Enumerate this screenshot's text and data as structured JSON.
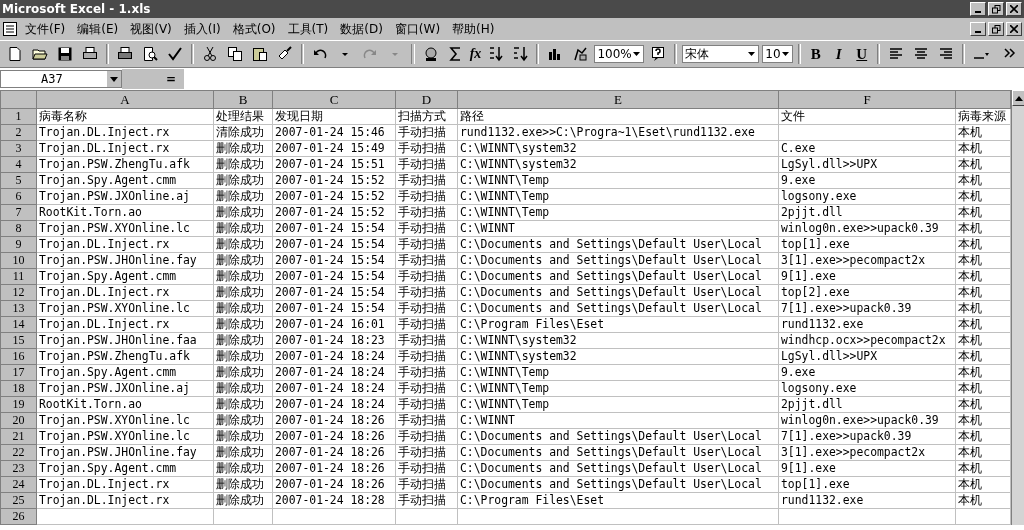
{
  "window": {
    "title": "Microsoft Excel - 1.xls"
  },
  "menu": [
    "文件(F)",
    "编辑(E)",
    "视图(V)",
    "插入(I)",
    "格式(O)",
    "工具(T)",
    "数据(D)",
    "窗口(W)",
    "帮助(H)"
  ],
  "toolbar": {
    "function_button": "fx",
    "zoom": "100%",
    "font": "宋体",
    "font_size": "10",
    "format_buttons": [
      "B",
      "I",
      "U"
    ]
  },
  "formula_bar": {
    "name_box": "A37",
    "equals": "="
  },
  "columns": [
    "A",
    "B",
    "C",
    "D",
    "E",
    "F"
  ],
  "rows": [
    {
      "number": "1",
      "cells": [
        "病毒名称",
        "处理结果",
        "发现日期",
        "扫描方式",
        "路径",
        "文件",
        "病毒来源"
      ]
    },
    {
      "number": "2",
      "cells": [
        "Trojan.DL.Inject.rx",
        "清除成功",
        "2007-01-24 15:46",
        "手动扫描",
        "rund1132.exe>>C:\\Progra~1\\Eset\\rund1132.exe",
        null,
        "本机"
      ]
    },
    {
      "number": "3",
      "cells": [
        "Trojan.DL.Inject.rx",
        "删除成功",
        "2007-01-24 15:49",
        "手动扫描",
        "C:\\WINNT\\system32",
        "C.exe",
        "本机"
      ]
    },
    {
      "number": "4",
      "cells": [
        "Trojan.PSW.ZhengTu.afk",
        "删除成功",
        "2007-01-24 15:51",
        "手动扫描",
        "C:\\WINNT\\system32",
        "LgSyl.dll>>UPX",
        "本机"
      ]
    },
    {
      "number": "5",
      "cells": [
        "Trojan.Spy.Agent.cmm",
        "删除成功",
        "2007-01-24 15:52",
        "手动扫描",
        "C:\\WINNT\\Temp",
        "9.exe",
        "本机"
      ]
    },
    {
      "number": "6",
      "cells": [
        "Trojan.PSW.JXOnline.aj",
        "删除成功",
        "2007-01-24 15:52",
        "手动扫描",
        "C:\\WINNT\\Temp",
        "logsony.exe",
        "本机"
      ]
    },
    {
      "number": "7",
      "cells": [
        "RootKit.Torn.ao",
        "删除成功",
        "2007-01-24 15:52",
        "手动扫描",
        "C:\\WINNT\\Temp",
        "2pjjt.dll",
        "本机"
      ]
    },
    {
      "number": "8",
      "cells": [
        "Trojan.PSW.XYOnline.lc",
        "删除成功",
        "2007-01-24 15:54",
        "手动扫描",
        "C:\\WINNT",
        "winlog0n.exe>>upack0.39",
        "本机"
      ]
    },
    {
      "number": "9",
      "cells": [
        "Trojan.DL.Inject.rx",
        "删除成功",
        "2007-01-24 15:54",
        "手动扫描",
        "C:\\Documents and Settings\\Default User\\Local",
        "top[1].exe",
        "本机"
      ]
    },
    {
      "number": "10",
      "cells": [
        "Trojan.PSW.JHOnline.fay",
        "删除成功",
        "2007-01-24 15:54",
        "手动扫描",
        "C:\\Documents and Settings\\Default User\\Local",
        "3[1].exe>>pecompact2x",
        "本机"
      ]
    },
    {
      "number": "11",
      "cells": [
        "Trojan.Spy.Agent.cmm",
        "删除成功",
        "2007-01-24 15:54",
        "手动扫描",
        "C:\\Documents and Settings\\Default User\\Local",
        "9[1].exe",
        "本机"
      ]
    },
    {
      "number": "12",
      "cells": [
        "Trojan.DL.Inject.rx",
        "删除成功",
        "2007-01-24 15:54",
        "手动扫描",
        "C:\\Documents and Settings\\Default User\\Local",
        "top[2].exe",
        "本机"
      ]
    },
    {
      "number": "13",
      "cells": [
        "Trojan.PSW.XYOnline.lc",
        "删除成功",
        "2007-01-24 15:54",
        "手动扫描",
        "C:\\Documents and Settings\\Default User\\Local",
        "7[1].exe>>upack0.39",
        "本机"
      ]
    },
    {
      "number": "14",
      "cells": [
        "Trojan.DL.Inject.rx",
        "删除成功",
        "2007-01-24 16:01",
        "手动扫描",
        "C:\\Program Files\\Eset",
        "rund1132.exe",
        "本机"
      ]
    },
    {
      "number": "15",
      "cells": [
        "Trojan.PSW.JHOnline.faa",
        "删除成功",
        "2007-01-24 18:23",
        "手动扫描",
        "C:\\WINNT\\system32",
        "windhcp.ocx>>pecompact2x",
        "本机"
      ]
    },
    {
      "number": "16",
      "cells": [
        "Trojan.PSW.ZhengTu.afk",
        "删除成功",
        "2007-01-24 18:24",
        "手动扫描",
        "C:\\WINNT\\system32",
        "LgSyl.dll>>UPX",
        "本机"
      ]
    },
    {
      "number": "17",
      "cells": [
        "Trojan.Spy.Agent.cmm",
        "删除成功",
        "2007-01-24 18:24",
        "手动扫描",
        "C:\\WINNT\\Temp",
        "9.exe",
        "本机"
      ]
    },
    {
      "number": "18",
      "cells": [
        "Trojan.PSW.JXOnline.aj",
        "删除成功",
        "2007-01-24 18:24",
        "手动扫描",
        "C:\\WINNT\\Temp",
        "logsony.exe",
        "本机"
      ]
    },
    {
      "number": "19",
      "cells": [
        "RootKit.Torn.ao",
        "删除成功",
        "2007-01-24 18:24",
        "手动扫描",
        "C:\\WINNT\\Temp",
        "2pjjt.dll",
        "本机"
      ]
    },
    {
      "number": "20",
      "cells": [
        "Trojan.PSW.XYOnline.lc",
        "删除成功",
        "2007-01-24 18:26",
        "手动扫描",
        "C:\\WINNT",
        "winlog0n.exe>>upack0.39",
        "本机"
      ]
    },
    {
      "number": "21",
      "cells": [
        "Trojan.PSW.XYOnline.lc",
        "删除成功",
        "2007-01-24 18:26",
        "手动扫描",
        "C:\\Documents and Settings\\Default User\\Local",
        "7[1].exe>>upack0.39",
        "本机"
      ]
    },
    {
      "number": "22",
      "cells": [
        "Trojan.PSW.JHOnline.fay",
        "删除成功",
        "2007-01-24 18:26",
        "手动扫描",
        "C:\\Documents and Settings\\Default User\\Local",
        "3[1].exe>>pecompact2x",
        "本机"
      ]
    },
    {
      "number": "23",
      "cells": [
        "Trojan.Spy.Agent.cmm",
        "删除成功",
        "2007-01-24 18:26",
        "手动扫描",
        "C:\\Documents and Settings\\Default User\\Local",
        "9[1].exe",
        "本机"
      ]
    },
    {
      "number": "24",
      "cells": [
        "Trojan.DL.Inject.rx",
        "删除成功",
        "2007-01-24 18:26",
        "手动扫描",
        "C:\\Documents and Settings\\Default User\\Local",
        "top[1].exe",
        "本机"
      ]
    },
    {
      "number": "25",
      "cells": [
        "Trojan.DL.Inject.rx",
        "删除成功",
        "2007-01-24 18:28",
        "手动扫描",
        "C:\\Program Files\\Eset",
        "rund1132.exe",
        "本机"
      ]
    },
    {
      "number": "26"
    }
  ]
}
